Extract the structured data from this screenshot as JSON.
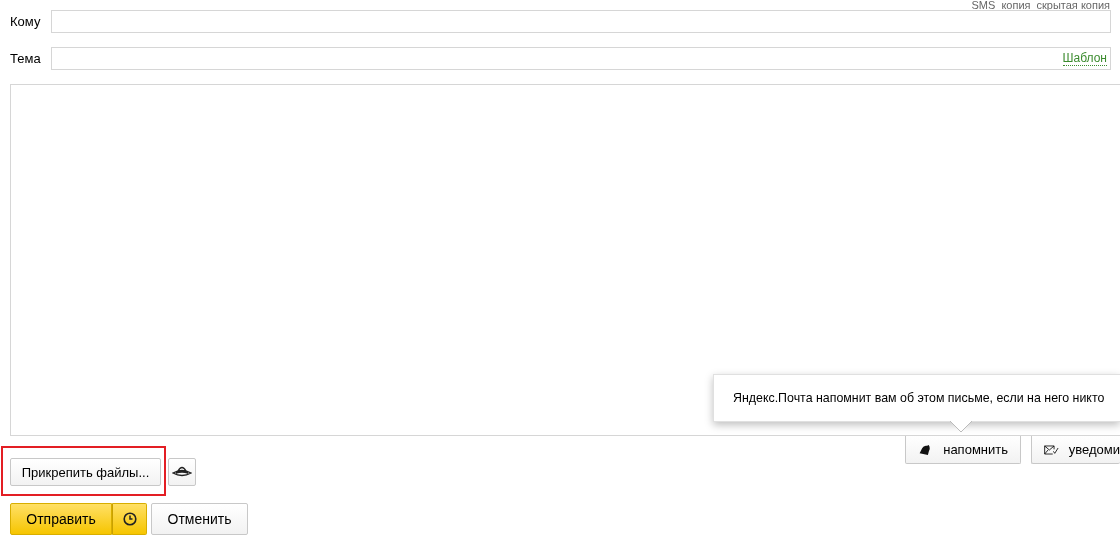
{
  "copy_links": [
    {
      "label": "SMS"
    },
    {
      "label": "копия"
    },
    {
      "label": "скрытая копия"
    }
  ],
  "fields": [
    {
      "label": "Кому"
    },
    {
      "label": "Тема",
      "link": "Шаблон"
    }
  ],
  "tooltip": {
    "text": "Яндекс.Почта напомнит вам об этом письме, если на него никто"
  },
  "reminder_buttons": [
    {
      "label": "напомнить",
      "kind": "bell"
    },
    {
      "label": "уведоми",
      "kind": "envelope"
    }
  ],
  "attach_button": {
    "label": "Прикрепить файлы..."
  },
  "send_button": {
    "label": "Отправить"
  },
  "cancel_button": {
    "label": "Отменить"
  }
}
